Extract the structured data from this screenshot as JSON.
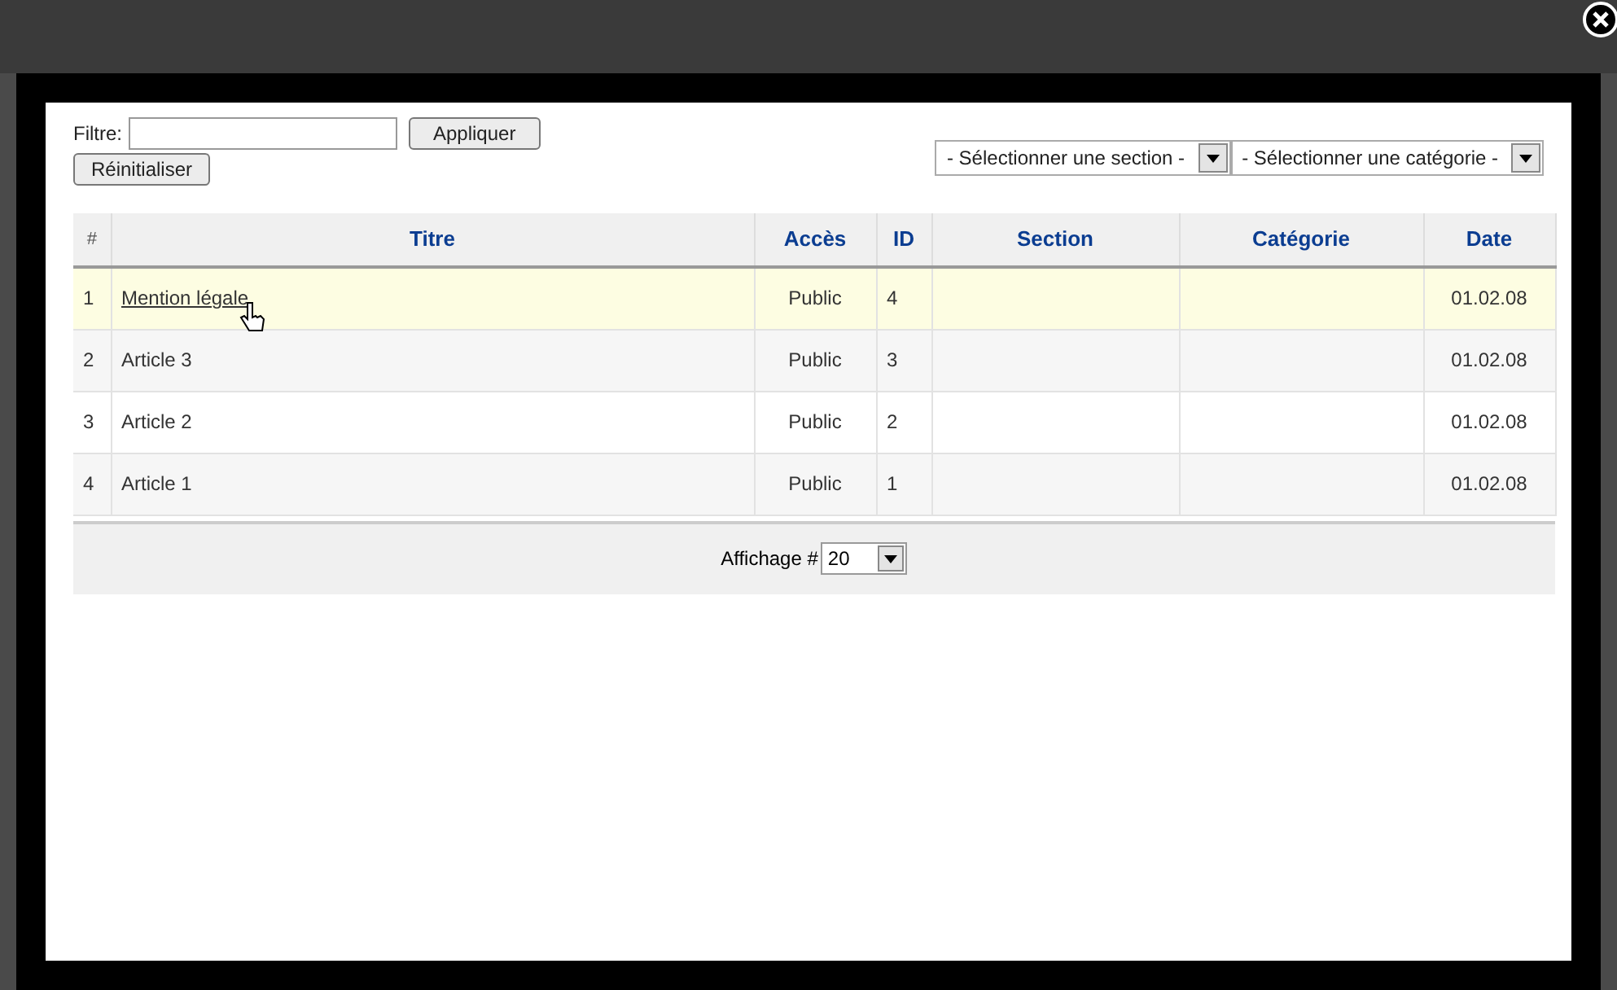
{
  "filter": {
    "label": "Filtre:",
    "apply_button": "Appliquer",
    "reset_button": "Réinitialiser"
  },
  "selects": [
    {
      "value": "- Sélectionner une section -"
    },
    {
      "value": "- Sélectionner une catégorie -"
    }
  ],
  "table": {
    "columns": [
      "#",
      "Titre",
      "Accès",
      "ID",
      "Section",
      "Catégorie",
      "Date"
    ],
    "rows": [
      {
        "cells": [
          "1",
          "Mention légale",
          "Public",
          "4",
          null,
          null,
          "01.02.08"
        ],
        "highlighted": true
      },
      {
        "cells": [
          "2",
          "Article 3",
          "Public",
          "3",
          null,
          null,
          "01.02.08"
        ],
        "highlighted": false
      },
      {
        "cells": [
          "3",
          "Article 2",
          "Public",
          "2",
          null,
          null,
          "01.02.08"
        ],
        "highlighted": false
      },
      {
        "cells": [
          "4",
          "Article 1",
          "Public",
          "1",
          null,
          null,
          "01.02.08"
        ],
        "highlighted": false
      }
    ]
  },
  "pagination": {
    "label": "Affichage #",
    "value": "20"
  }
}
